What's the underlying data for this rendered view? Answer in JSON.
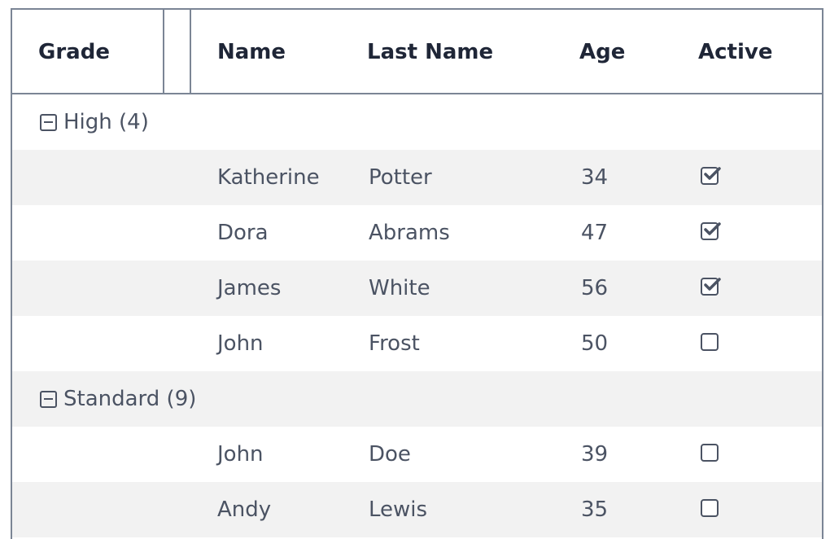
{
  "columns": {
    "grade": "Grade",
    "name": "Name",
    "last_name": "Last Name",
    "age": "Age",
    "active": "Active"
  },
  "groups": [
    {
      "label": "High (4)",
      "rows": [
        {
          "name": "Katherine",
          "last_name": "Potter",
          "age": "34",
          "active": true
        },
        {
          "name": "Dora",
          "last_name": "Abrams",
          "age": "47",
          "active": true
        },
        {
          "name": "James",
          "last_name": "White",
          "age": "56",
          "active": true
        },
        {
          "name": "John",
          "last_name": "Frost",
          "age": "50",
          "active": false
        }
      ]
    },
    {
      "label": "Standard (9)",
      "rows": [
        {
          "name": "John",
          "last_name": "Doe",
          "age": "39",
          "active": false
        },
        {
          "name": "Andy",
          "last_name": "Lewis",
          "age": "35",
          "active": false
        }
      ]
    }
  ],
  "colors": {
    "border": "#7b8595",
    "header_text": "#1f2637",
    "body_text": "#4b5363",
    "alt_row": "#f2f2f2"
  }
}
